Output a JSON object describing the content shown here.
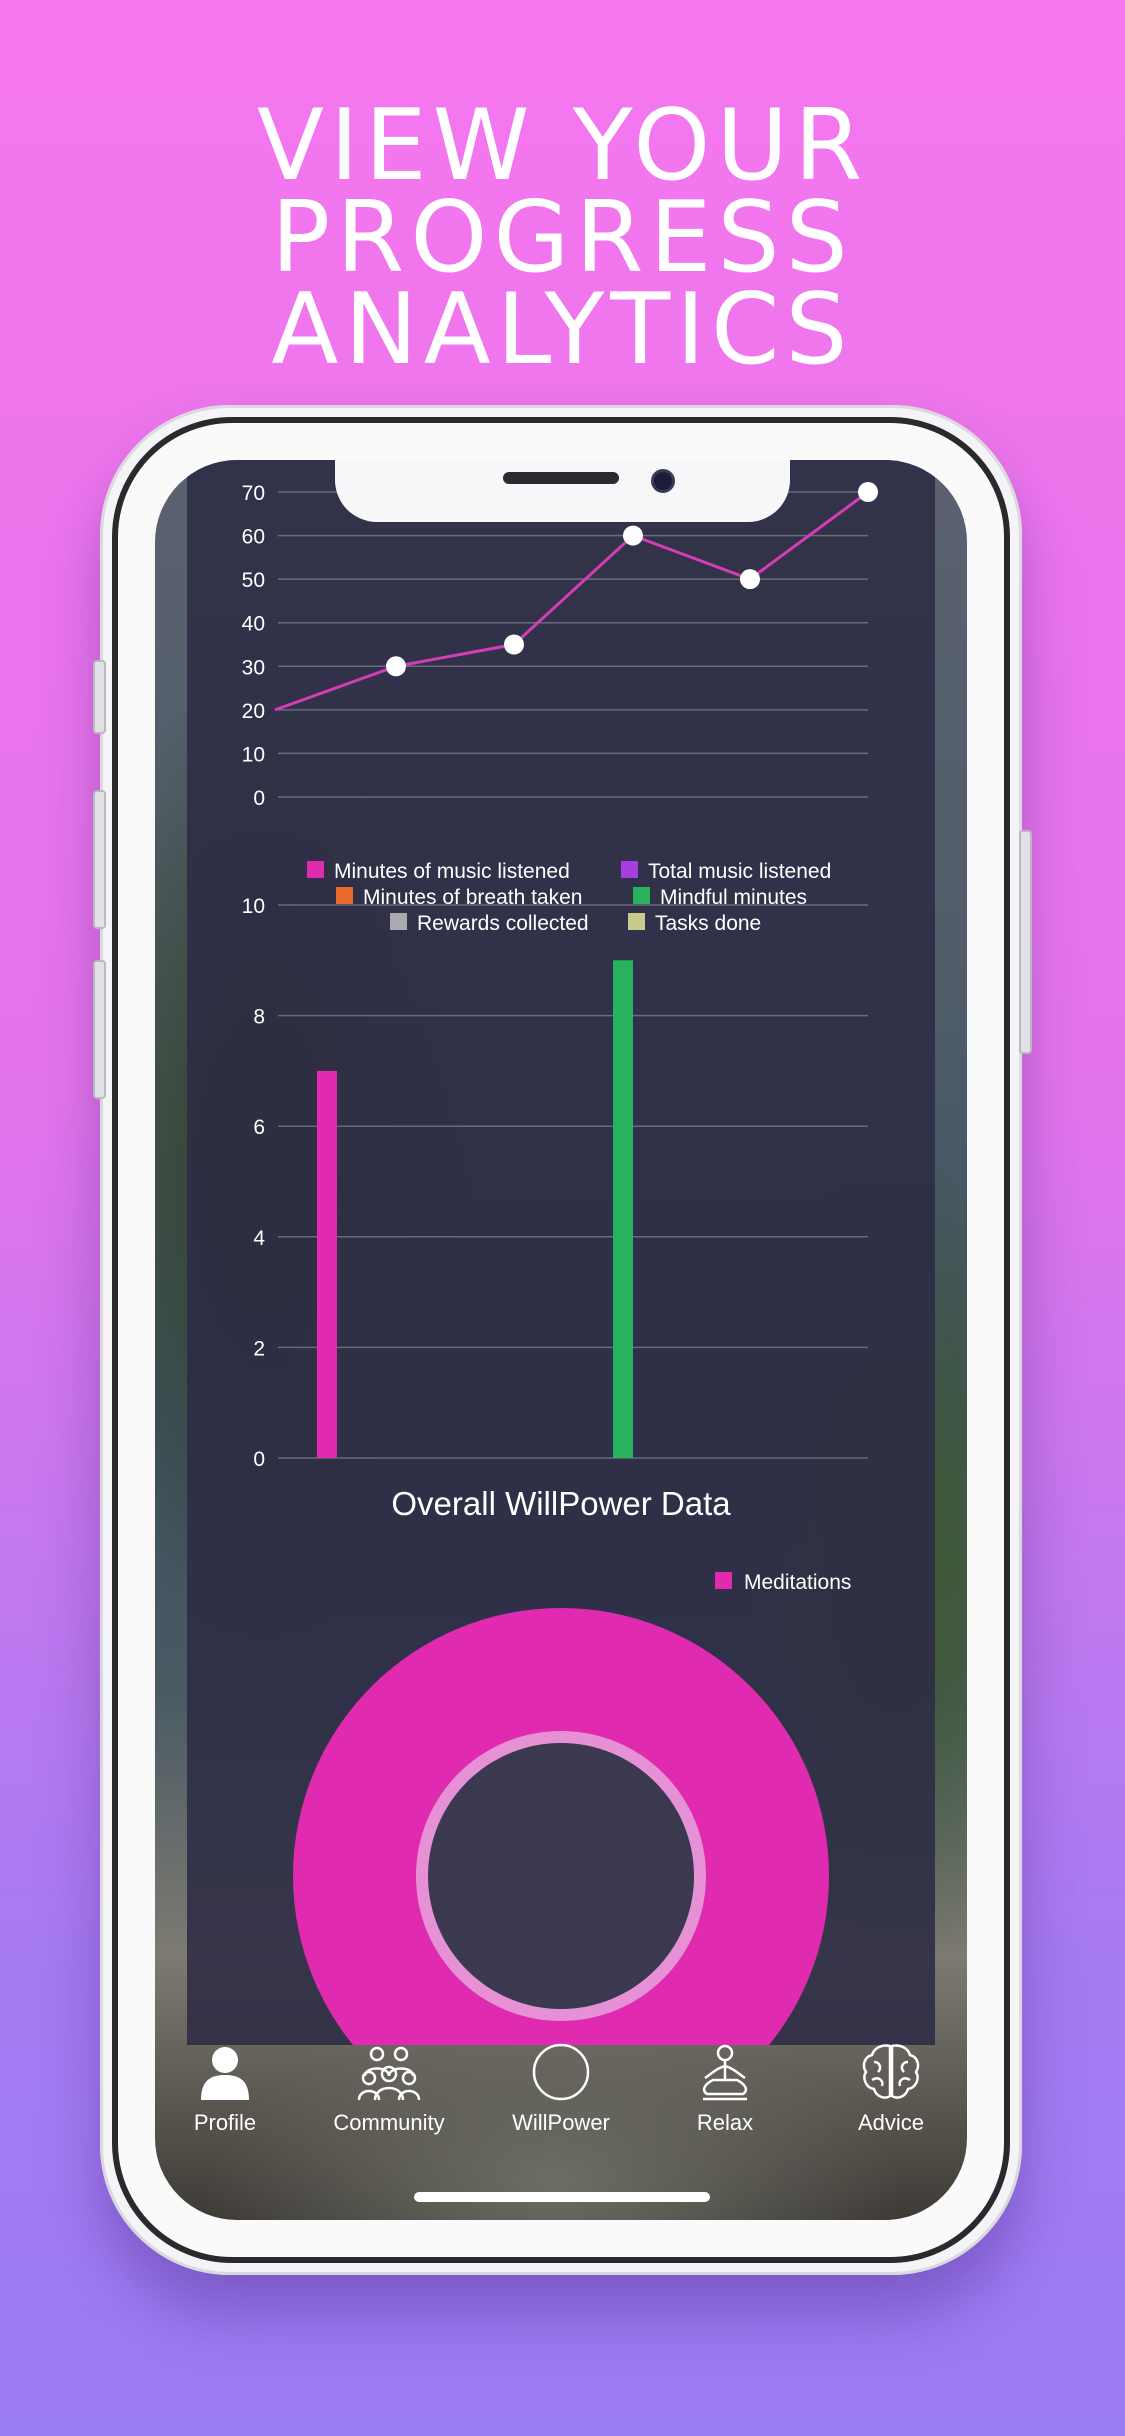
{
  "headline": {
    "line1": "VIEW YOUR",
    "line2": "PROGRESS",
    "line3": "ANALYTICS"
  },
  "colors": {
    "accent_pink": "#e02bb1",
    "line_pink": "#d53db6",
    "bar_green": "#27b35e",
    "legend_purple": "#a63ee0",
    "legend_orange": "#e86a2a",
    "legend_gray": "#a9a9ae",
    "legend_khaki": "#c9c98a"
  },
  "chart_data": [
    {
      "type": "line",
      "x": [
        1,
        2,
        3,
        4,
        5,
        6
      ],
      "y": [
        20,
        30,
        35,
        60,
        50,
        70
      ],
      "ylim": [
        0,
        70
      ],
      "yticks": [
        "0",
        "10",
        "20",
        "30",
        "40",
        "50",
        "60",
        "70"
      ],
      "grid": true
    },
    {
      "type": "bar",
      "series": [
        {
          "name": "Minutes of music listened",
          "value": 7,
          "color": "#e02bb1"
        },
        {
          "name": "Total music listened",
          "value": 0,
          "color": "#a63ee0"
        },
        {
          "name": "Minutes of breath taken",
          "value": 0,
          "color": "#e86a2a"
        },
        {
          "name": "Mindful minutes",
          "value": 9,
          "color": "#27b35e"
        },
        {
          "name": "Rewards collected",
          "value": 0,
          "color": "#a9a9ae"
        },
        {
          "name": "Tasks done",
          "value": 0,
          "color": "#c9c98a"
        }
      ],
      "ylim": [
        0,
        10
      ],
      "yticks": [
        "0",
        "2",
        "4",
        "6",
        "8",
        "10"
      ],
      "grid": true,
      "legend_placement": "top"
    },
    {
      "type": "pie",
      "title": "Overall WillPower Data",
      "slices": [
        {
          "name": "Meditations",
          "value": 100,
          "color": "#e02bb1"
        }
      ],
      "legend_placement": "top-right"
    }
  ],
  "tabs": [
    {
      "label": "Profile",
      "icon": "person-icon"
    },
    {
      "label": "Community",
      "icon": "community-icon"
    },
    {
      "label": "WillPower",
      "icon": "circle-icon"
    },
    {
      "label": "Relax",
      "icon": "meditation-icon"
    },
    {
      "label": "Advice",
      "icon": "brain-icon"
    }
  ]
}
